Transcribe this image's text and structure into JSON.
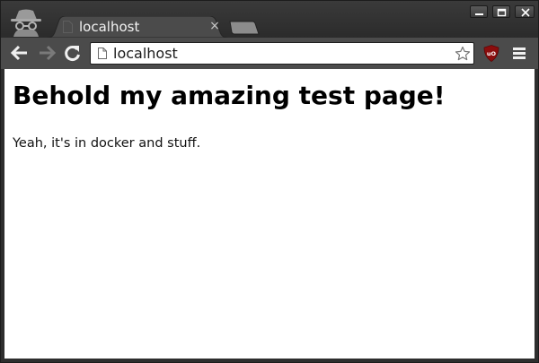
{
  "browser": {
    "tab": {
      "title": "localhost",
      "close_glyph": "×",
      "favicon": "page-icon"
    },
    "window_controls": [
      "minimize-icon",
      "maximize-icon",
      "close-icon"
    ],
    "toolbar": {
      "back_icon": "back-arrow-icon",
      "forward_icon": "forward-arrow-icon",
      "reload_icon": "reload-icon",
      "url": "localhost",
      "star_icon": "star-icon",
      "extension_icon": "ublock-origin-icon",
      "menu_icon": "hamburger-menu-icon"
    },
    "incognito_icon": "incognito-icon",
    "colors": {
      "frame": "#2e2e2e",
      "toolbar": "#4b4b4b",
      "tab": "#4b4b4b",
      "ublock_red": "#8b0d0d"
    }
  },
  "page": {
    "heading": "Behold my amazing test page!",
    "paragraph": "Yeah, it's in docker and stuff."
  }
}
